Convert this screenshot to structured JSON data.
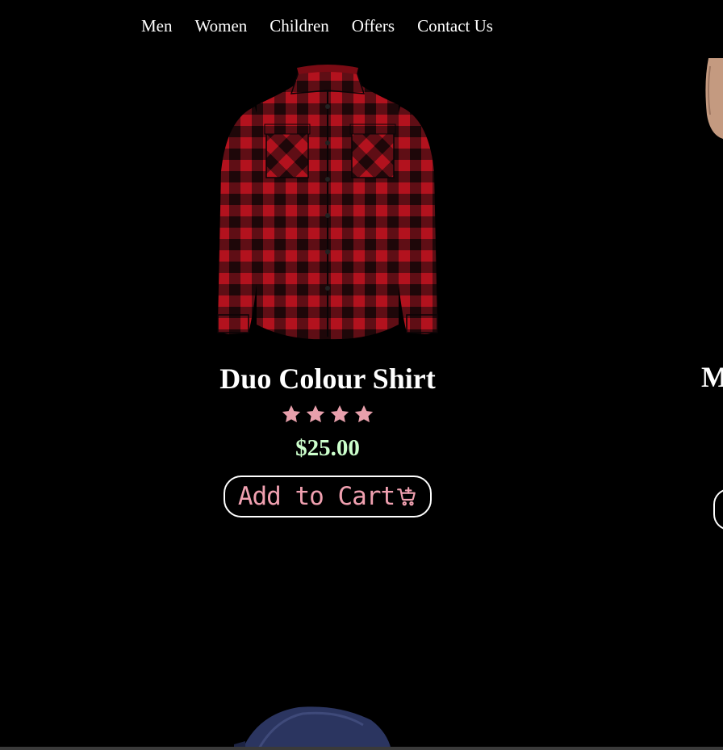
{
  "nav": {
    "items": [
      {
        "label": "Men"
      },
      {
        "label": "Women"
      },
      {
        "label": "Children"
      },
      {
        "label": "Offers"
      },
      {
        "label": "Contact Us"
      }
    ]
  },
  "product": {
    "title": "Duo Colour Shirt",
    "rating_stars": 4,
    "price": "$25.00",
    "cart_label": "Add to Cart",
    "image_icon": "red-black-plaid-shirt",
    "star_color": "#e8a0ac",
    "price_color": "#ccffcc",
    "cart_text_color": "#f0a0b0"
  },
  "next_product": {
    "title_partial": "M"
  }
}
